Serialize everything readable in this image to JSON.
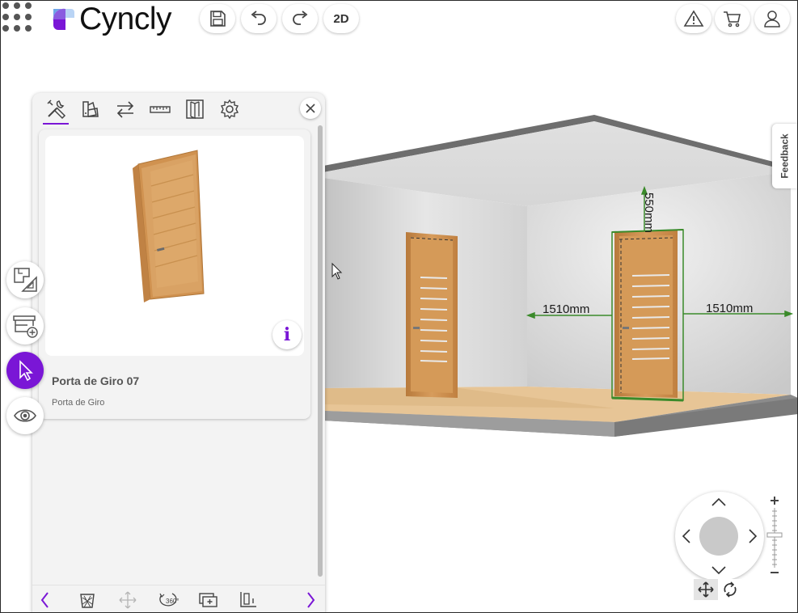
{
  "app": {
    "name": "Cyncly"
  },
  "toolbar": {
    "view_mode_label": "2D"
  },
  "feedback": {
    "label": "Feedback"
  },
  "panel": {
    "product": {
      "title": "Porta de Giro 07",
      "subtitle": "Porta de Giro",
      "info_glyph": "i"
    }
  },
  "dimensions": {
    "height": "550mm",
    "left": "1510mm",
    "right": "1510mm"
  },
  "colors": {
    "accent": "#7a16d6",
    "dimension_line": "#3a8a2a",
    "wood": "#c98d4e"
  },
  "icons": {
    "topbar": [
      "apps-grid-icon",
      "save-icon",
      "undo-icon",
      "redo-icon",
      "warning-icon",
      "cart-icon",
      "user-icon"
    ],
    "side": [
      "floorplan-icon",
      "add-furniture-icon",
      "select-pointer-icon",
      "visibility-eye-icon"
    ],
    "panel_tabs": [
      "tools-icon",
      "materials-icon",
      "swap-icon",
      "ruler-icon",
      "door-icon",
      "settings-gear-icon"
    ],
    "panel_footer": [
      "prev-chevron-icon",
      "delete-basket-icon",
      "move-arrows-icon",
      "rotate-360-icon",
      "duplicate-icon",
      "align-icon",
      "next-chevron-icon"
    ],
    "navigation": [
      "nav-up-icon",
      "nav-down-icon",
      "nav-left-icon",
      "nav-right-icon",
      "pan-mode-icon",
      "orbit-mode-icon",
      "zoom-in-icon",
      "zoom-out-icon"
    ]
  }
}
